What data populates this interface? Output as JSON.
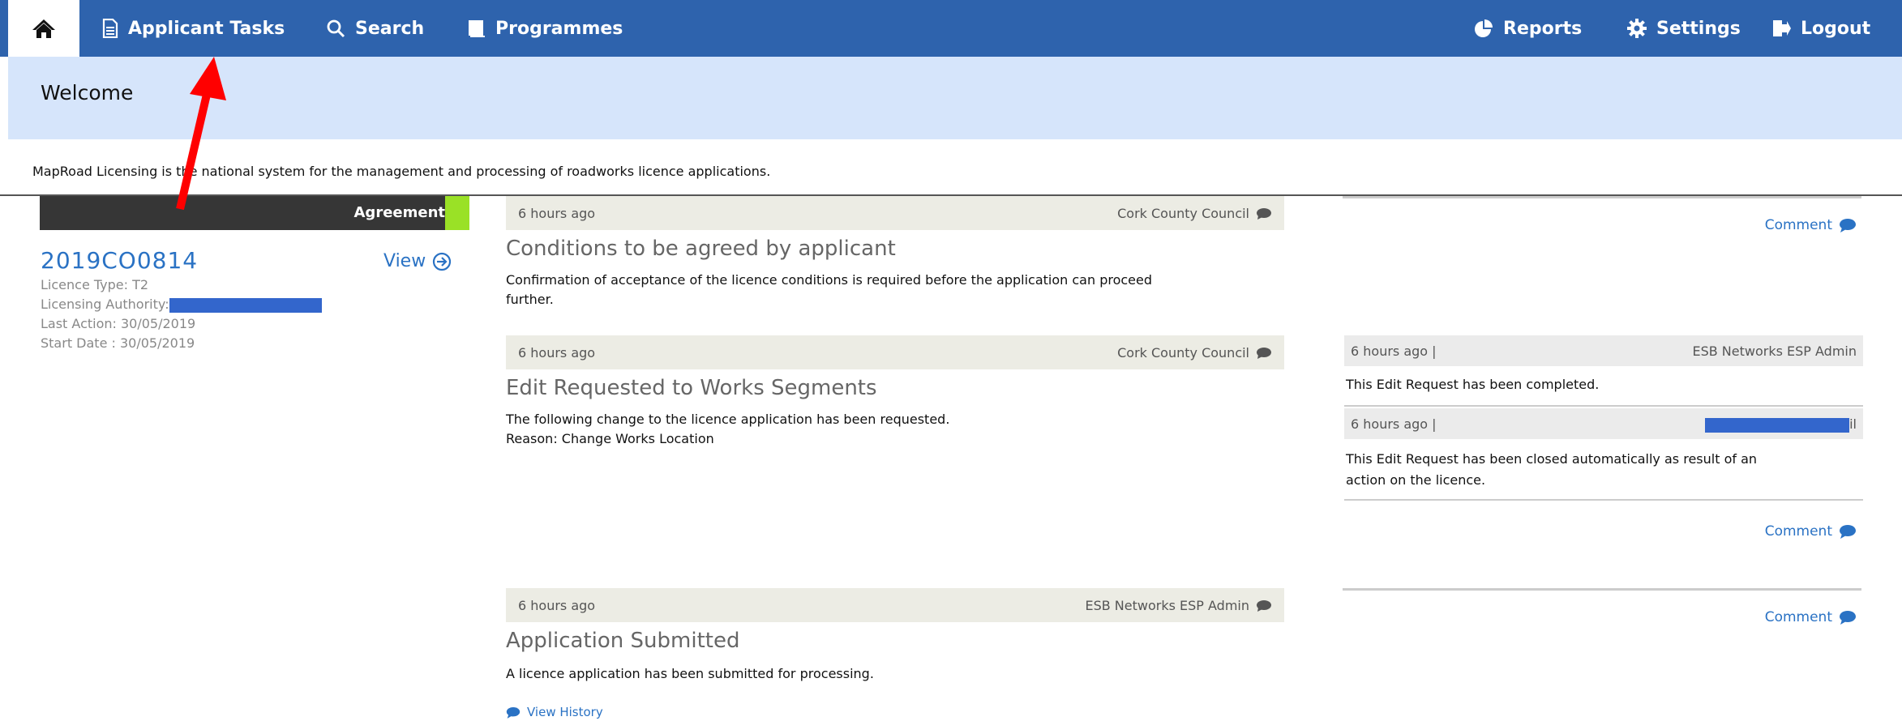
{
  "nav": {
    "home_icon": "home-icon",
    "items": [
      {
        "label": "Applicant Tasks",
        "icon": "document-icon"
      },
      {
        "label": "Search",
        "icon": "search-icon"
      },
      {
        "label": "Programmes",
        "icon": "book-icon"
      },
      {
        "label": "Reports",
        "icon": "pie-chart-icon"
      },
      {
        "label": "Settings",
        "icon": "gear-icon"
      },
      {
        "label": "Logout",
        "icon": "logout-icon"
      }
    ]
  },
  "welcome": {
    "title": "Welcome"
  },
  "intro_text": "MapRoad Licensing is the national system for the management and processing of roadworks licence applications.",
  "licence": {
    "status": "Agreement",
    "number": "2019CO0814",
    "view_label": "View",
    "licence_type": "Licence Type: T2",
    "licensing_authority_label": "Licensing Authority:",
    "last_action": "Last Action: 30/05/2019",
    "start_date": "Start Date : 30/05/2019"
  },
  "timeline": [
    {
      "time": "6 hours ago",
      "author": "Cork County Council",
      "title": "Conditions to be agreed by applicant",
      "body_line1": "Confirmation of acceptance of the licence conditions is required before the application can proceed",
      "body_line2": "further.",
      "comment_label": "Comment"
    },
    {
      "time": "6 hours ago",
      "author": "Cork County Council",
      "title": "Edit Requested to Works Segments",
      "body_line1": "The following change to the licence application has been requested.",
      "body_line2": "Reason: Change Works Location",
      "comment_label": "Comment",
      "replies": [
        {
          "time": "6 hours ago |",
          "author": "ESB Networks ESP Admin",
          "text": "This Edit Request has been completed."
        },
        {
          "time": "6 hours ago |",
          "author_suffix": "il",
          "text_line1": "This Edit Request has been closed automatically as result of an",
          "text_line2": "action on the licence."
        }
      ]
    },
    {
      "time": "6 hours ago",
      "author": "ESB Networks ESP Admin",
      "title": "Application Submitted",
      "body_line1": "A licence application has been submitted for processing.",
      "comment_label": "Comment"
    }
  ],
  "view_history_label": "View History",
  "colors": {
    "nav_bg": "#2e63ad",
    "welcome_bg": "#d6e5fb",
    "status_accent": "#9ae126",
    "link": "#2a72c4",
    "annotation_arrow": "#ff0000"
  }
}
